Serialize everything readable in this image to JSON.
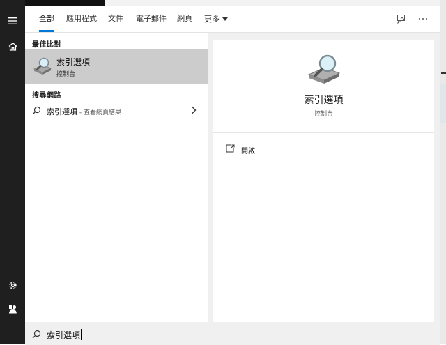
{
  "tabs": [
    {
      "label": "全部",
      "active": true
    },
    {
      "label": "應用程式",
      "active": false
    },
    {
      "label": "文件",
      "active": false
    },
    {
      "label": "電子郵件",
      "active": false
    },
    {
      "label": "網頁",
      "active": false
    },
    {
      "label": "更多",
      "active": false
    }
  ],
  "header_icons": [
    "feedback-icon",
    "more-options-icon"
  ],
  "rail_icons": [
    "menu-icon",
    "home-icon",
    "settings-icon",
    "user-icon"
  ],
  "results": {
    "best_match_heading": "最佳比對",
    "best_match": {
      "title": "索引選項",
      "subtitle": "控制台",
      "icon": "indexing-options-icon"
    },
    "web_heading": "搜尋網路",
    "web_query": "索引選項",
    "web_hint": " - 查看網頁結果"
  },
  "preview": {
    "title": "索引選項",
    "subtitle": "控制台",
    "actions": [
      {
        "label": "開啟",
        "icon": "open-icon"
      }
    ]
  },
  "search": {
    "value": "索引選項"
  },
  "colors": {
    "accent": "#0078d7",
    "rail": "#1f1f1f",
    "selected": "#cccccc"
  }
}
